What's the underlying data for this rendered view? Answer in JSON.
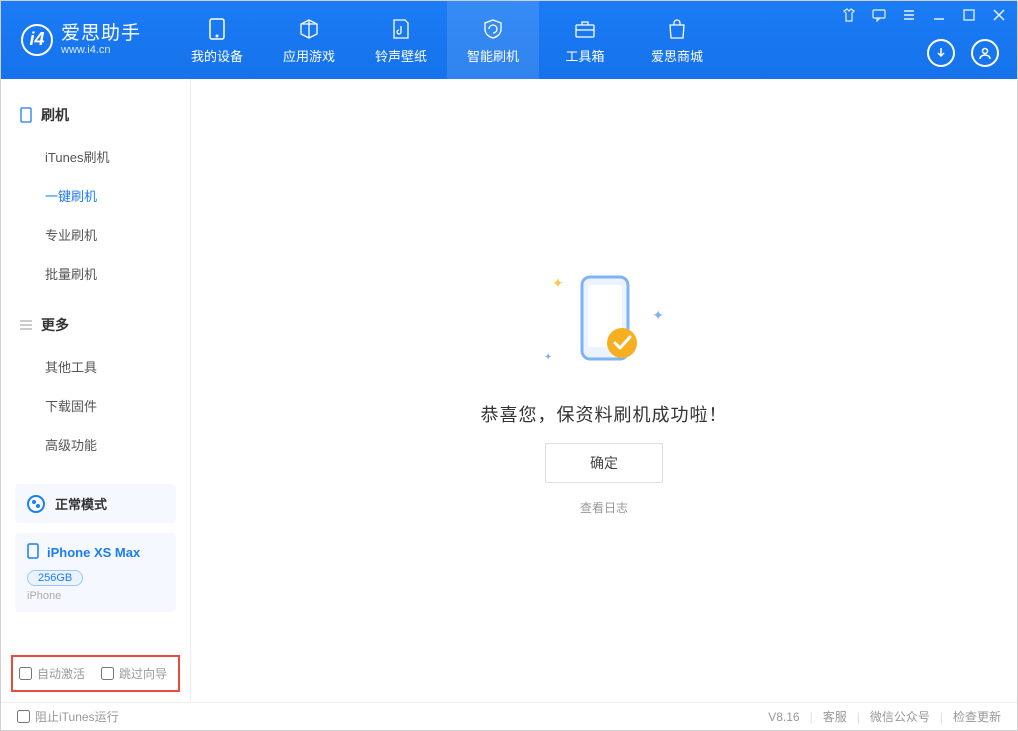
{
  "app": {
    "name": "爱思助手",
    "url": "www.i4.cn"
  },
  "nav": [
    {
      "label": "我的设备"
    },
    {
      "label": "应用游戏"
    },
    {
      "label": "铃声壁纸"
    },
    {
      "label": "智能刷机"
    },
    {
      "label": "工具箱"
    },
    {
      "label": "爱思商城"
    }
  ],
  "sidebar": {
    "section1": {
      "title": "刷机",
      "items": [
        "iTunes刷机",
        "一键刷机",
        "专业刷机",
        "批量刷机"
      ]
    },
    "section2": {
      "title": "更多",
      "items": [
        "其他工具",
        "下载固件",
        "高级功能"
      ]
    },
    "mode": "正常模式",
    "device": {
      "name": "iPhone XS Max",
      "capacity": "256GB",
      "type": "iPhone"
    },
    "chk_auto": "自动激活",
    "chk_skip": "跳过向导"
  },
  "main": {
    "success": "恭喜您，保资料刷机成功啦！",
    "confirm": "确定",
    "log": "查看日志"
  },
  "status": {
    "block_itunes": "阻止iTunes运行",
    "version": "V8.16",
    "support": "客服",
    "wechat": "微信公众号",
    "update": "检查更新"
  }
}
